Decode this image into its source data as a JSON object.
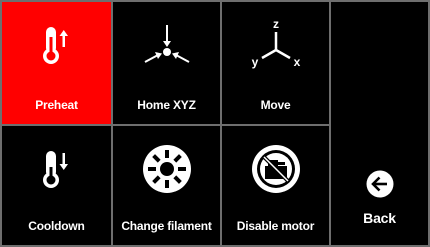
{
  "menu": {
    "preheat": {
      "label": "Preheat",
      "icon": "thermometer-up-icon"
    },
    "home": {
      "label": "Home XYZ",
      "icon": "home-axes-icon"
    },
    "move": {
      "label": "Move",
      "icon": "xyz-axes-icon"
    },
    "cooldown": {
      "label": "Cooldown",
      "icon": "thermometer-down-icon"
    },
    "change_filament": {
      "label": "Change filament",
      "icon": "filament-spool-icon"
    },
    "disable_motor": {
      "label": "Disable motor",
      "icon": "motor-disabled-icon"
    },
    "back": {
      "label": "Back",
      "icon": "arrow-left-circle-icon"
    }
  },
  "colors": {
    "selected": "#ff0000",
    "tile": "#000000",
    "grid_lines": "#6e6e6e",
    "foreground": "#ffffff"
  }
}
